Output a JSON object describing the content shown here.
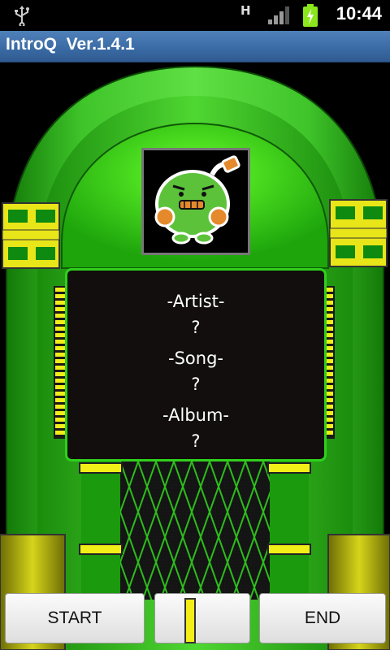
{
  "status_bar": {
    "network_label": "H",
    "clock": "10:44"
  },
  "title_bar": {
    "title": "IntroQ  Ver.1.4.1"
  },
  "info_panel": {
    "artist_label": "-Artist-",
    "artist_value": "?",
    "song_label": "-Song-",
    "song_value": "?",
    "album_label": "-Album-",
    "album_value": "?"
  },
  "buttons": {
    "start_label": "START",
    "end_label": "END"
  },
  "colors": {
    "jukebox_green": "#2fd01c",
    "title_bar_blue": "#3a6aa3",
    "accent_yellow": "#f1ee18"
  },
  "icons": [
    "usb-icon",
    "signal-icon",
    "battery-charging-icon",
    "mascot-icon"
  ]
}
